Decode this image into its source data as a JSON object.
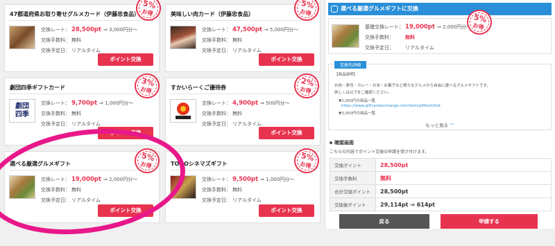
{
  "cards": [
    {
      "title": "47都道府県お取り寄せグルメカード（伊藤忠食品）",
      "rate_label": "交換レート：",
      "pt": "28,500pt",
      "yen": "⇒ 3,000円分～",
      "fee_label": "交換手数料：",
      "fee": "無料",
      "time_label": "交換予定日：",
      "time": "リアルタイム",
      "button": "ポイント交換",
      "badge_pct": "5%",
      "badge_txt": "お得"
    },
    {
      "title": "美味しい肉カード（伊藤忠食品）",
      "rate_label": "交換レート：",
      "pt": "47,500pt",
      "yen": "⇒ 5,000円分～",
      "fee_label": "交換手数料：",
      "fee": "無料",
      "time_label": "交換予定日：",
      "time": "リアルタイム",
      "button": "ポイント交換",
      "badge_pct": "5%",
      "badge_txt": "お得"
    },
    {
      "title": "劇団四季ギフトカード",
      "rate_label": "交換レート：",
      "pt": "9,700pt",
      "yen": "⇒ 1,000円分～",
      "fee_label": "交換手数料：",
      "fee": "無料",
      "time_label": "交換予定日：",
      "time": "リアルタイム",
      "button": "ポイント交換",
      "badge_pct": "3%",
      "badge_txt": "お得",
      "logo": "劇団\n四季"
    },
    {
      "title": "すかいらーくご優待券",
      "rate_label": "交換レート：",
      "pt": "4,900pt",
      "yen": "⇒ 500円分～",
      "fee_label": "交換手数料：",
      "fee": "無料",
      "time_label": "交換予定日：",
      "time": "リアルタイム",
      "button": "ポイント交換",
      "badge_pct": "2%",
      "badge_txt": "お得"
    },
    {
      "title": "選べる厳選グルメギフト",
      "rate_label": "交換レート：",
      "pt": "19,000pt",
      "yen": "⇒ 2,000円分～",
      "fee_label": "交換手数料：",
      "fee": "無料",
      "time_label": "交換予定日：",
      "time": "リアルタイム",
      "button": "ポイント交換",
      "badge_pct": "5%",
      "badge_txt": "お得"
    },
    {
      "title": "TOHOシネマズギフト",
      "rate_label": "交換レート：",
      "pt": "9,500pt",
      "yen": "⇒ 1,000円分～",
      "fee_label": "交換手数料：",
      "fee": "無料",
      "time_label": "交換予定日：",
      "time": "リアルタイム",
      "button": "ポイント交換",
      "badge_pct": "5%",
      "badge_txt": "お得"
    }
  ],
  "panel": {
    "header": "選べる厳選グルメギフトに交換",
    "summary": {
      "rate_label": "基礎交換レート：",
      "pt": "19,000pt",
      "yen": "⇒ 2,000円分～",
      "fee_label": "交換手数料：",
      "fee": "無料",
      "time_label": "交換予定日：",
      "time": "リアルタイム",
      "badge_pct": "5%",
      "badge_txt": "お得"
    },
    "exchange": {
      "tab": "交換先詳細",
      "heading": "【商品説明】",
      "desc1": "お肉・寿司・カレー・お米・お菓子など様々なグルメから自由に選べるグルメギフトです。",
      "desc2": "詳しくは以下をご確認ください。",
      "item1": "▼2,000円の商品一覧",
      "link": "https://www.giftcardexchange.com/item/gifttest/link",
      "item2": "▼3,000円の商品一覧",
      "more": "もっと見る"
    },
    "confirm": {
      "title": "確認画面",
      "note": "こちらの内容でポイント交換の申請を受け付けます。",
      "rows": [
        {
          "k": "交換ポイント",
          "v": "28,500pt"
        },
        {
          "k": "交換手数料",
          "v": "無料"
        },
        {
          "k": "合計交換ポイント",
          "v": "28,500pt"
        },
        {
          "k": "交換後ポイント",
          "v": "29,114pt ⇒ 614pt"
        }
      ]
    },
    "back": "戻る",
    "apply": "申請する"
  },
  "colors": {
    "accent": "#e8334f",
    "header_blue": "#2a8fd8",
    "highlight": "#e8188a"
  }
}
